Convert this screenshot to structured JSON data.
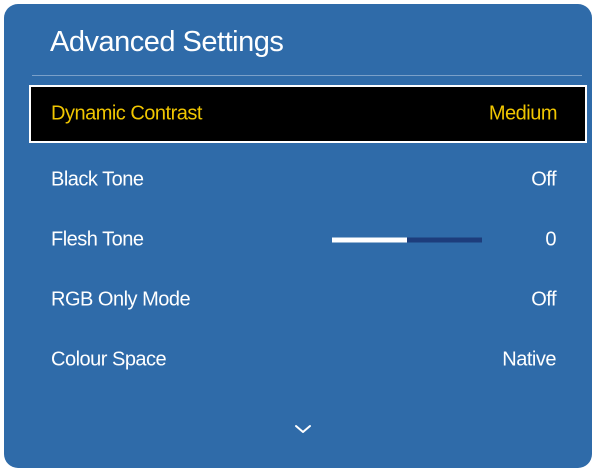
{
  "menu": {
    "title": "Advanced Settings",
    "items": [
      {
        "label": "Dynamic Contrast",
        "value": "Medium",
        "selected": true
      },
      {
        "label": "Black Tone",
        "value": "Off"
      },
      {
        "label": "Flesh Tone",
        "value": "0",
        "slider_level": 0.5
      },
      {
        "label": "RGB Only Mode",
        "value": "Off"
      },
      {
        "label": "Colour Space",
        "value": "Native"
      }
    ],
    "scroll_icon": "chevron-down-icon"
  },
  "colors": {
    "panel_background": "#2f6ba9",
    "selected_background": "#000000",
    "selected_text": "#f0c600",
    "text": "#ffffff",
    "slider_track": "#1d3d7c",
    "slider_fill": "#ffffff"
  }
}
